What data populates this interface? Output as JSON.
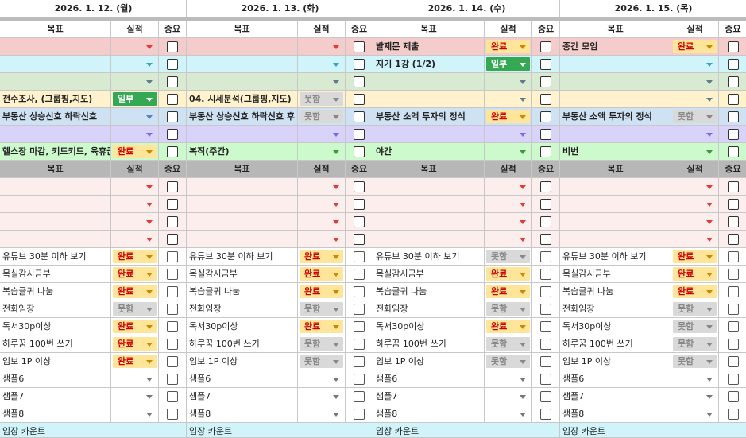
{
  "days": [
    {
      "date": "2026. 1. 12. (월)"
    },
    {
      "date": "2026. 1. 13. (화)"
    },
    {
      "date": "2026. 1. 14. (수)"
    },
    {
      "date": "2026. 1. 15. (목)"
    }
  ],
  "headers": {
    "goal": "목표",
    "result": "실적",
    "important": "중요"
  },
  "status_colors": {
    "완료": {
      "bg": "#ffe599",
      "fg": "#cc0000"
    },
    "일부": {
      "bg": "#34a853",
      "fg": "#ffffff"
    },
    "못함": {
      "bg": "#d9d9d9",
      "fg": "#888888"
    }
  },
  "row_colors": [
    "#f4cccc",
    "#d0f4fa",
    "#d9ead3",
    "#fff2cc",
    "#cfe2f3",
    "#d9d2f9",
    "#cdfacd"
  ],
  "arrow_colors": [
    "#e53935",
    "#2aa7c9",
    "#607d8b",
    "#607d8b",
    "#5b7fbf",
    "#7b68ee",
    "#3c9a3c"
  ],
  "top_rows": [
    [
      {
        "goal": "",
        "result": ""
      },
      {
        "goal": "",
        "result": ""
      },
      {
        "goal": "발제문 제출",
        "result": "완료"
      },
      {
        "goal": "중간 모임",
        "result": "완료"
      }
    ],
    [
      {
        "goal": "",
        "result": ""
      },
      {
        "goal": "",
        "result": ""
      },
      {
        "goal": "지기 1강 (1/2)",
        "result": "일부"
      },
      {
        "goal": "",
        "result": ""
      }
    ],
    [
      {
        "goal": "",
        "result": ""
      },
      {
        "goal": "",
        "result": ""
      },
      {
        "goal": "",
        "result": ""
      },
      {
        "goal": "",
        "result": ""
      }
    ],
    [
      {
        "goal": "전수조사, (그룹핑,지도)",
        "result": "일부"
      },
      {
        "goal": "04. 시세분석(그룹핑,지도)",
        "result": "못함"
      },
      {
        "goal": "",
        "result": ""
      },
      {
        "goal": "",
        "result": ""
      }
    ],
    [
      {
        "goal": "부동산 상승신호 하락신호",
        "result": ""
      },
      {
        "goal": "부동산 상승신호 하락신호 후",
        "result": "못함"
      },
      {
        "goal": "부동산 소액 투자의 정석",
        "result": "완료"
      },
      {
        "goal": "부동산 소액 투자의 정석",
        "result": "못함"
      }
    ],
    [
      {
        "goal": "",
        "result": ""
      },
      {
        "goal": "",
        "result": ""
      },
      {
        "goal": "",
        "result": ""
      },
      {
        "goal": "",
        "result": ""
      }
    ],
    [
      {
        "goal": "헬스장 마감, 키드키드, 육휴급",
        "result": "완료"
      },
      {
        "goal": "복직(주간)",
        "result": ""
      },
      {
        "goal": "야간",
        "result": ""
      },
      {
        "goal": "비번",
        "result": ""
      }
    ]
  ],
  "bottom_rows": [
    [
      {
        "goal": "",
        "result": ""
      },
      {
        "goal": "",
        "result": ""
      },
      {
        "goal": "",
        "result": ""
      },
      {
        "goal": "",
        "result": ""
      }
    ],
    [
      {
        "goal": "",
        "result": ""
      },
      {
        "goal": "",
        "result": ""
      },
      {
        "goal": "",
        "result": ""
      },
      {
        "goal": "",
        "result": ""
      }
    ],
    [
      {
        "goal": "",
        "result": ""
      },
      {
        "goal": "",
        "result": ""
      },
      {
        "goal": "",
        "result": ""
      },
      {
        "goal": "",
        "result": ""
      }
    ],
    [
      {
        "goal": "",
        "result": ""
      },
      {
        "goal": "",
        "result": ""
      },
      {
        "goal": "",
        "result": ""
      },
      {
        "goal": "",
        "result": ""
      }
    ],
    [
      {
        "goal": "유튜브 30분 이하 보기",
        "result": "완료"
      },
      {
        "goal": "유튜브 30분 이하 보기",
        "result": "완료"
      },
      {
        "goal": "유튜브 30분 이하 보기",
        "result": "못함"
      },
      {
        "goal": "유튜브 30분 이하 보기",
        "result": "완료"
      }
    ],
    [
      {
        "goal": "목실감시금부",
        "result": "완료"
      },
      {
        "goal": "목실감시금부",
        "result": "완료"
      },
      {
        "goal": "목실감시금부",
        "result": "완료"
      },
      {
        "goal": "목실감시금부",
        "result": "완료"
      }
    ],
    [
      {
        "goal": "복습글귀 나눔",
        "result": "완료"
      },
      {
        "goal": "복습글귀 나눔",
        "result": "완료"
      },
      {
        "goal": "복습글귀 나눔",
        "result": "완료"
      },
      {
        "goal": "복습글귀 나눔",
        "result": "완료"
      }
    ],
    [
      {
        "goal": "전화임장",
        "result": "못함"
      },
      {
        "goal": "전화임장",
        "result": "못함"
      },
      {
        "goal": "전화임장",
        "result": "못함"
      },
      {
        "goal": "전화임장",
        "result": "못함"
      }
    ],
    [
      {
        "goal": "독서30p이상",
        "result": "완료"
      },
      {
        "goal": "독서30p이상",
        "result": "완료"
      },
      {
        "goal": "독서30p이상",
        "result": "완료"
      },
      {
        "goal": "독서30p이상",
        "result": "못함"
      }
    ],
    [
      {
        "goal": "하루꿈 100번 쓰기",
        "result": "완료"
      },
      {
        "goal": "하루꿈 100번 쓰기",
        "result": "못함"
      },
      {
        "goal": "하루꿈 100번 쓰기",
        "result": "못함"
      },
      {
        "goal": "하루꿈 100번 쓰기",
        "result": "못함"
      }
    ],
    [
      {
        "goal": "임보 1P 이상",
        "result": "완료"
      },
      {
        "goal": "임보 1P 이상",
        "result": "못함"
      },
      {
        "goal": "임보 1P 이상",
        "result": "못함"
      },
      {
        "goal": "임보 1P 이상",
        "result": "못함"
      }
    ],
    [
      {
        "goal": "샘플6",
        "result": ""
      },
      {
        "goal": "샘플6",
        "result": ""
      },
      {
        "goal": "샘플6",
        "result": ""
      },
      {
        "goal": "샘플6",
        "result": ""
      }
    ],
    [
      {
        "goal": "샘플7",
        "result": ""
      },
      {
        "goal": "샘플7",
        "result": ""
      },
      {
        "goal": "샘플7",
        "result": ""
      },
      {
        "goal": "샘플7",
        "result": ""
      }
    ],
    [
      {
        "goal": "샘플8",
        "result": ""
      },
      {
        "goal": "샘플8",
        "result": ""
      },
      {
        "goal": "샘플8",
        "result": ""
      },
      {
        "goal": "샘플8",
        "result": ""
      }
    ]
  ],
  "footer": [
    {
      "label": "임장 카운트"
    },
    {
      "label": "임장 카운트"
    },
    {
      "label": "임장 카운트"
    },
    {
      "label": "임장 카운트"
    }
  ]
}
